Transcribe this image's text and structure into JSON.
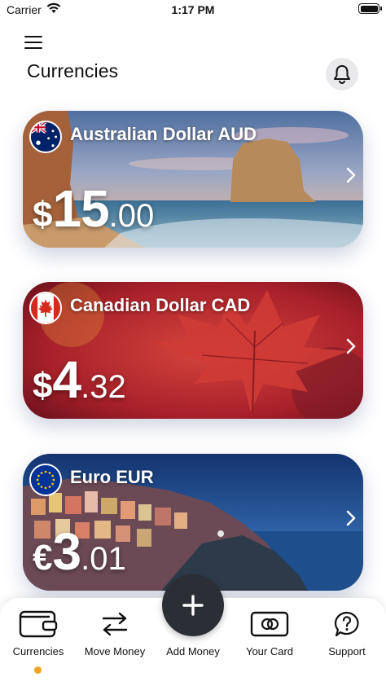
{
  "status_bar": {
    "carrier": "Carrier",
    "time": "1:17 PM"
  },
  "header": {
    "title": "Currencies",
    "menu_icon": "hamburger-icon",
    "bell_icon": "bell-icon"
  },
  "cards": [
    {
      "name": "Australian Dollar AUD",
      "symbol": "$",
      "whole": "15",
      "decimal": ".00",
      "flag": "australia-flag"
    },
    {
      "name": "Canadian Dollar CAD",
      "symbol": "$",
      "whole": "4",
      "decimal": ".32",
      "flag": "canada-flag"
    },
    {
      "name": "Euro EUR",
      "symbol": "€",
      "whole": "3",
      "decimal": ".01",
      "flag": "eu-flag"
    }
  ],
  "tabs": [
    {
      "label": "Currencies",
      "icon": "wallet-icon",
      "active": true
    },
    {
      "label": "Move Money",
      "icon": "transfer-arrows-icon"
    },
    {
      "label": "Add Money",
      "icon": "plus-icon"
    },
    {
      "label": "Your Card",
      "icon": "card-icon"
    },
    {
      "label": "Support",
      "icon": "help-icon"
    }
  ],
  "colors": {
    "active_indicator": "#f0a323",
    "fab": "#2b2e35",
    "bell_bg": "#e9e9eb"
  }
}
